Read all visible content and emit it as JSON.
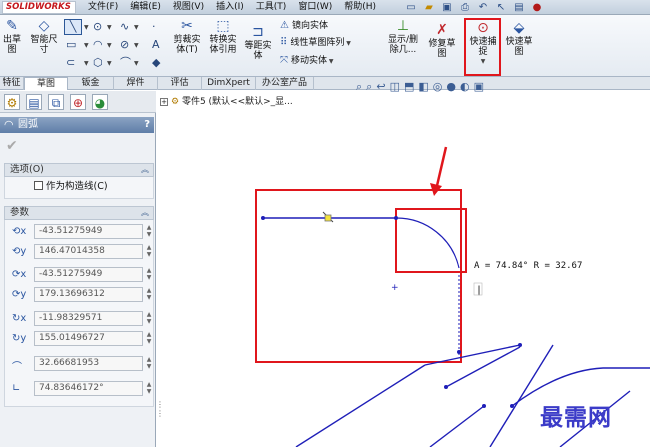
{
  "app": {
    "logo": "SOLIDWORKS"
  },
  "menu": [
    "文件(F)",
    "编辑(E)",
    "视图(V)",
    "插入(I)",
    "工具(T)",
    "窗口(W)",
    "帮助(H)"
  ],
  "quick_icons": [
    "new-file-icon",
    "open-folder-icon",
    "save-icon",
    "print-icon",
    "undo-icon",
    "select-icon",
    "rebuild-icon",
    "traffic-light-icon"
  ],
  "ribbon": {
    "exit_sketch": "出草\n图",
    "smart_dimension": "智能尺\n寸",
    "trim": "剪裁实\n体(T)",
    "convert": "转换实\n体引用",
    "offset": "等距实\n体",
    "mirror": "镜向实体",
    "linear_pattern": "线性草图阵列",
    "move": "移动实体",
    "display_delete": "显示/删\n除几...",
    "repair": "修复草\n图",
    "quick_snap": "快速捕\n捉",
    "quick_sketch": "快速草\n图"
  },
  "tabs": [
    "特征",
    "草图",
    "钣金",
    "焊件",
    "评估",
    "DimXpert",
    "办公室产品"
  ],
  "active_tab": "草图",
  "pm": {
    "title": "圆弧",
    "help": "?",
    "options_header": "选项(O)",
    "construction": "作为构造线(C)",
    "params_header": "参数",
    "params": [
      {
        "icon": "center-x-icon",
        "value": "-43.51275949"
      },
      {
        "icon": "center-y-icon",
        "value": "146.47014358"
      },
      {
        "icon": "start-x-icon",
        "value": "-43.51275949"
      },
      {
        "icon": "start-y-icon",
        "value": "179.13696312"
      },
      {
        "icon": "end-x-icon",
        "value": "-11.98329571"
      },
      {
        "icon": "end-y-icon",
        "value": "155.01496727"
      },
      {
        "icon": "radius-icon",
        "value": "32.66681953"
      },
      {
        "icon": "angle-icon",
        "value": "74.83646172°"
      }
    ]
  },
  "tree": {
    "label": "零件5 (默认<<默认>_显..."
  },
  "view_tools": [
    "zoom-fit-icon",
    "zoom-area-icon",
    "previous-view-icon",
    "section-view-icon",
    "view-orient-icon",
    "display-style-icon",
    "hide-show-icon",
    "appearance-icon",
    "scene-icon",
    "view-settings-icon"
  ],
  "canvas": {
    "dimension_text": "A = 74.84°  R = 32.67",
    "watermark": "最需网",
    "highlight_color": "#e0161c",
    "sketch_color": "#1f1fb8"
  }
}
